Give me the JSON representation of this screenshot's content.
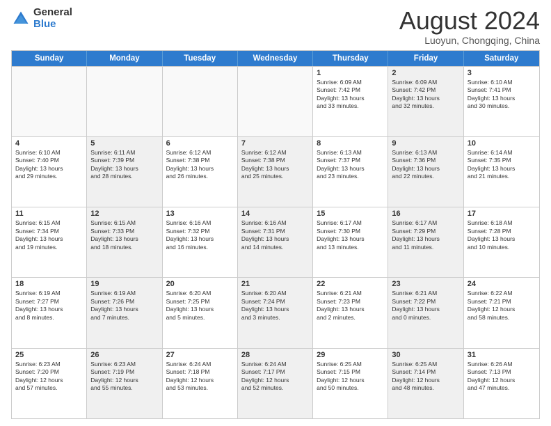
{
  "logo": {
    "general": "General",
    "blue": "Blue"
  },
  "title": "August 2024",
  "subtitle": "Luoyun, Chongqing, China",
  "days": [
    "Sunday",
    "Monday",
    "Tuesday",
    "Wednesday",
    "Thursday",
    "Friday",
    "Saturday"
  ],
  "weeks": [
    [
      {
        "num": "",
        "text": "",
        "empty": true
      },
      {
        "num": "",
        "text": "",
        "empty": true
      },
      {
        "num": "",
        "text": "",
        "empty": true
      },
      {
        "num": "",
        "text": "",
        "empty": true
      },
      {
        "num": "1",
        "text": "Sunrise: 6:09 AM\nSunset: 7:42 PM\nDaylight: 13 hours\nand 33 minutes.",
        "empty": false,
        "shaded": false
      },
      {
        "num": "2",
        "text": "Sunrise: 6:09 AM\nSunset: 7:42 PM\nDaylight: 13 hours\nand 32 minutes.",
        "empty": false,
        "shaded": true
      },
      {
        "num": "3",
        "text": "Sunrise: 6:10 AM\nSunset: 7:41 PM\nDaylight: 13 hours\nand 30 minutes.",
        "empty": false,
        "shaded": false
      }
    ],
    [
      {
        "num": "4",
        "text": "Sunrise: 6:10 AM\nSunset: 7:40 PM\nDaylight: 13 hours\nand 29 minutes.",
        "empty": false,
        "shaded": false
      },
      {
        "num": "5",
        "text": "Sunrise: 6:11 AM\nSunset: 7:39 PM\nDaylight: 13 hours\nand 28 minutes.",
        "empty": false,
        "shaded": true
      },
      {
        "num": "6",
        "text": "Sunrise: 6:12 AM\nSunset: 7:38 PM\nDaylight: 13 hours\nand 26 minutes.",
        "empty": false,
        "shaded": false
      },
      {
        "num": "7",
        "text": "Sunrise: 6:12 AM\nSunset: 7:38 PM\nDaylight: 13 hours\nand 25 minutes.",
        "empty": false,
        "shaded": true
      },
      {
        "num": "8",
        "text": "Sunrise: 6:13 AM\nSunset: 7:37 PM\nDaylight: 13 hours\nand 23 minutes.",
        "empty": false,
        "shaded": false
      },
      {
        "num": "9",
        "text": "Sunrise: 6:13 AM\nSunset: 7:36 PM\nDaylight: 13 hours\nand 22 minutes.",
        "empty": false,
        "shaded": true
      },
      {
        "num": "10",
        "text": "Sunrise: 6:14 AM\nSunset: 7:35 PM\nDaylight: 13 hours\nand 21 minutes.",
        "empty": false,
        "shaded": false
      }
    ],
    [
      {
        "num": "11",
        "text": "Sunrise: 6:15 AM\nSunset: 7:34 PM\nDaylight: 13 hours\nand 19 minutes.",
        "empty": false,
        "shaded": false
      },
      {
        "num": "12",
        "text": "Sunrise: 6:15 AM\nSunset: 7:33 PM\nDaylight: 13 hours\nand 18 minutes.",
        "empty": false,
        "shaded": true
      },
      {
        "num": "13",
        "text": "Sunrise: 6:16 AM\nSunset: 7:32 PM\nDaylight: 13 hours\nand 16 minutes.",
        "empty": false,
        "shaded": false
      },
      {
        "num": "14",
        "text": "Sunrise: 6:16 AM\nSunset: 7:31 PM\nDaylight: 13 hours\nand 14 minutes.",
        "empty": false,
        "shaded": true
      },
      {
        "num": "15",
        "text": "Sunrise: 6:17 AM\nSunset: 7:30 PM\nDaylight: 13 hours\nand 13 minutes.",
        "empty": false,
        "shaded": false
      },
      {
        "num": "16",
        "text": "Sunrise: 6:17 AM\nSunset: 7:29 PM\nDaylight: 13 hours\nand 11 minutes.",
        "empty": false,
        "shaded": true
      },
      {
        "num": "17",
        "text": "Sunrise: 6:18 AM\nSunset: 7:28 PM\nDaylight: 13 hours\nand 10 minutes.",
        "empty": false,
        "shaded": false
      }
    ],
    [
      {
        "num": "18",
        "text": "Sunrise: 6:19 AM\nSunset: 7:27 PM\nDaylight: 13 hours\nand 8 minutes.",
        "empty": false,
        "shaded": false
      },
      {
        "num": "19",
        "text": "Sunrise: 6:19 AM\nSunset: 7:26 PM\nDaylight: 13 hours\nand 7 minutes.",
        "empty": false,
        "shaded": true
      },
      {
        "num": "20",
        "text": "Sunrise: 6:20 AM\nSunset: 7:25 PM\nDaylight: 13 hours\nand 5 minutes.",
        "empty": false,
        "shaded": false
      },
      {
        "num": "21",
        "text": "Sunrise: 6:20 AM\nSunset: 7:24 PM\nDaylight: 13 hours\nand 3 minutes.",
        "empty": false,
        "shaded": true
      },
      {
        "num": "22",
        "text": "Sunrise: 6:21 AM\nSunset: 7:23 PM\nDaylight: 13 hours\nand 2 minutes.",
        "empty": false,
        "shaded": false
      },
      {
        "num": "23",
        "text": "Sunrise: 6:21 AM\nSunset: 7:22 PM\nDaylight: 13 hours\nand 0 minutes.",
        "empty": false,
        "shaded": true
      },
      {
        "num": "24",
        "text": "Sunrise: 6:22 AM\nSunset: 7:21 PM\nDaylight: 12 hours\nand 58 minutes.",
        "empty": false,
        "shaded": false
      }
    ],
    [
      {
        "num": "25",
        "text": "Sunrise: 6:23 AM\nSunset: 7:20 PM\nDaylight: 12 hours\nand 57 minutes.",
        "empty": false,
        "shaded": false
      },
      {
        "num": "26",
        "text": "Sunrise: 6:23 AM\nSunset: 7:19 PM\nDaylight: 12 hours\nand 55 minutes.",
        "empty": false,
        "shaded": true
      },
      {
        "num": "27",
        "text": "Sunrise: 6:24 AM\nSunset: 7:18 PM\nDaylight: 12 hours\nand 53 minutes.",
        "empty": false,
        "shaded": false
      },
      {
        "num": "28",
        "text": "Sunrise: 6:24 AM\nSunset: 7:17 PM\nDaylight: 12 hours\nand 52 minutes.",
        "empty": false,
        "shaded": true
      },
      {
        "num": "29",
        "text": "Sunrise: 6:25 AM\nSunset: 7:15 PM\nDaylight: 12 hours\nand 50 minutes.",
        "empty": false,
        "shaded": false
      },
      {
        "num": "30",
        "text": "Sunrise: 6:25 AM\nSunset: 7:14 PM\nDaylight: 12 hours\nand 48 minutes.",
        "empty": false,
        "shaded": true
      },
      {
        "num": "31",
        "text": "Sunrise: 6:26 AM\nSunset: 7:13 PM\nDaylight: 12 hours\nand 47 minutes.",
        "empty": false,
        "shaded": false
      }
    ]
  ]
}
